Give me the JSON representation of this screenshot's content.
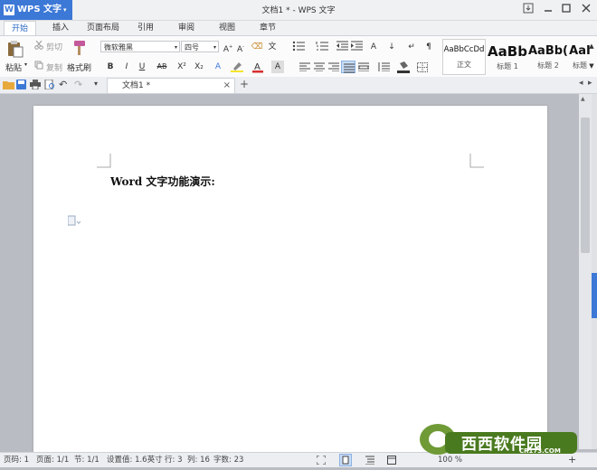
{
  "app": {
    "name": "WPS 文字",
    "logo_letter": "W",
    "menu_arrow": "▾"
  },
  "window": {
    "title": "文档1 * - WPS 文字"
  },
  "tabs": [
    "开始",
    "插入",
    "页面布局",
    "引用",
    "审阅",
    "视图",
    "章节"
  ],
  "ribbon": {
    "paste": "粘贴",
    "cut": "剪切",
    "copy": "复制",
    "format_painter": "格式刷",
    "font_name": "微软雅黑",
    "font_size": "四号",
    "styles": [
      {
        "sample": "AaBbCcDd",
        "label": "正文"
      },
      {
        "sample": "AaBb",
        "label": "标题 1"
      },
      {
        "sample": "AaBb(",
        "label": "标题 2"
      },
      {
        "sample": "AaI",
        "label": "标题"
      }
    ]
  },
  "document_tab": {
    "name": "文档1 *"
  },
  "document": {
    "heading": "Word  文字功能演示:"
  },
  "status": {
    "page_no": "页码: 1",
    "pages": "页面: 1/1",
    "section": "节: 1/1",
    "position": "设置值: 1.6英寸",
    "row": "行: 3",
    "col": "列: 16",
    "chars": "字数: 23",
    "zoom": "100 %"
  },
  "watermark": {
    "brand": "西西软件园",
    "url": "CR173.COM"
  },
  "colors": {
    "accent": "#3c78d6",
    "ribbon_bg": "#fbfbfc",
    "workspace": "#b9bcc2"
  }
}
